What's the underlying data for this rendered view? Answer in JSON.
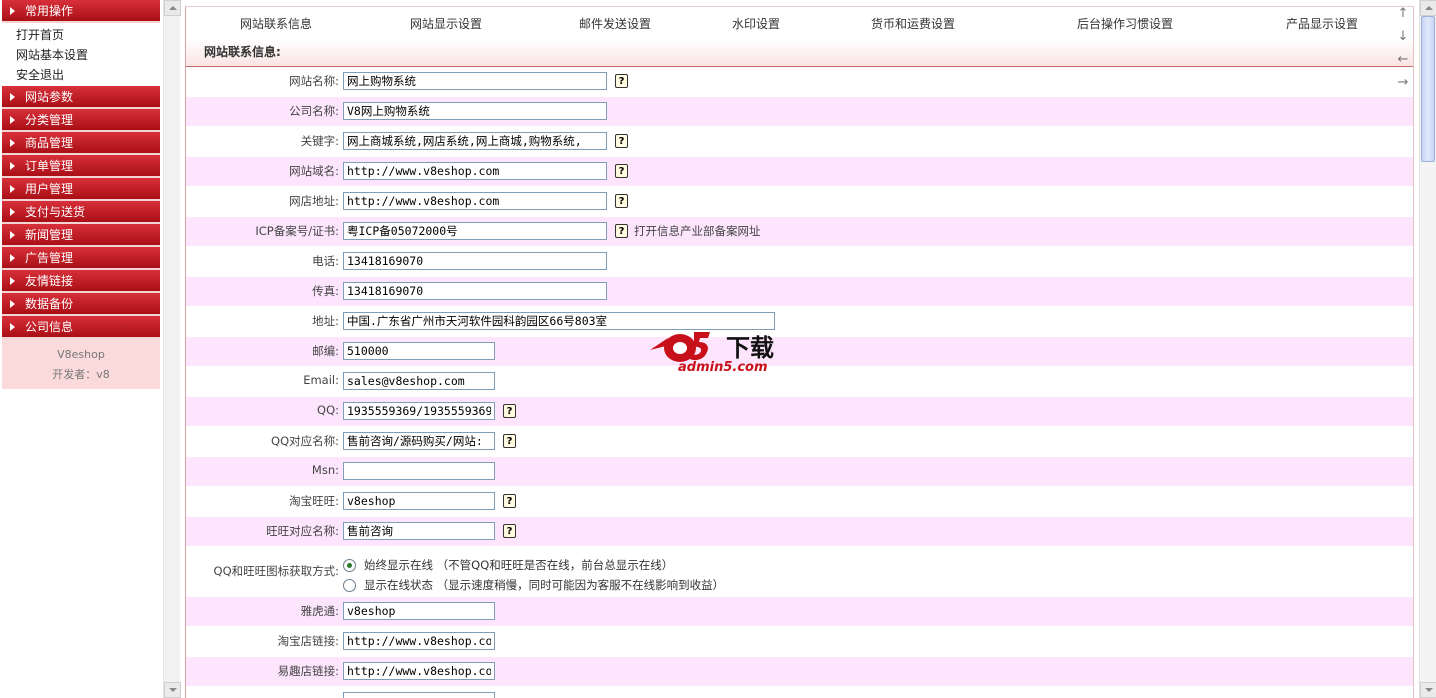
{
  "sidebar": {
    "groups": [
      {
        "label": "常用操作",
        "items": [
          "打开首页",
          "网站基本设置",
          "安全退出"
        ]
      },
      {
        "label": "网站参数"
      },
      {
        "label": "分类管理"
      },
      {
        "label": "商品管理"
      },
      {
        "label": "订单管理"
      },
      {
        "label": "用户管理"
      },
      {
        "label": "支付与送货"
      },
      {
        "label": "新闻管理"
      },
      {
        "label": "广告管理"
      },
      {
        "label": "友情链接"
      },
      {
        "label": "数据备份"
      },
      {
        "label": "公司信息"
      }
    ],
    "footer_name": "V8eshop",
    "footer_dev": "开发者：v8"
  },
  "tabs": [
    "网站联系信息",
    "网站显示设置",
    "邮件发送设置",
    "水印设置",
    "货币和运费设置",
    "后台操作习惯设置",
    "产品显示设置"
  ],
  "section_title": "网站联系信息:",
  "help_glyph": "?",
  "fields": {
    "site_name": {
      "label": "网站名称:",
      "value": "网上购物系统"
    },
    "company_name": {
      "label": "公司名称:",
      "value": "V8网上购物系统"
    },
    "keywords": {
      "label": "关键字:",
      "value": "网上商城系统,网店系统,网上商城,购物系统,"
    },
    "domain": {
      "label": "网站域名:",
      "value": "http://www.v8eshop.com"
    },
    "shop_url": {
      "label": "网店地址:",
      "value": "http://www.v8eshop.com"
    },
    "icp": {
      "label": "ICP备案号/证书:",
      "value": "粤ICP备05072000号",
      "note": "打开信息产业部备案网址"
    },
    "phone": {
      "label": "电话:",
      "value": "13418169070"
    },
    "fax": {
      "label": "传真:",
      "value": "13418169070"
    },
    "address": {
      "label": "地址:",
      "value": "中国.广东省广州市天河软件园科韵园区66号803室"
    },
    "zip": {
      "label": "邮编:",
      "value": "510000"
    },
    "email": {
      "label": "Email:",
      "value": "sales@v8eshop.com"
    },
    "qq": {
      "label": "QQ:",
      "value": "1935559369/1935559369"
    },
    "qq_names": {
      "label": "QQ对应名称:",
      "value": "售前咨询/源码购买/网站:"
    },
    "msn": {
      "label": "Msn:",
      "value": ""
    },
    "taobao_ww": {
      "label": "淘宝旺旺:",
      "value": "v8eshop"
    },
    "ww_name": {
      "label": "旺旺对应名称:",
      "value": "售前咨询"
    },
    "icon_mode": {
      "label": "QQ和旺旺图标获取方式:",
      "options": [
        "始终显示在线 （不管QQ和旺旺是否在线，前台总显示在线）",
        "显示在线状态 （显示速度稍慢，同时可能因为客服不在线影响到收益）"
      ],
      "selected": 0
    },
    "yahoo": {
      "label": "雅虎通:",
      "value": "v8eshop"
    },
    "taobao_link": {
      "label": "淘宝店链接:",
      "value": "http://www.v8eshop.co"
    },
    "yiqu_link": {
      "label": "易趣店链接:",
      "value": "http://www.v8eshop.co"
    }
  },
  "right_arrows": [
    "↑",
    "↓",
    "←",
    "→"
  ],
  "watermark": {
    "cn": "下载",
    "url": "admin5.com"
  }
}
